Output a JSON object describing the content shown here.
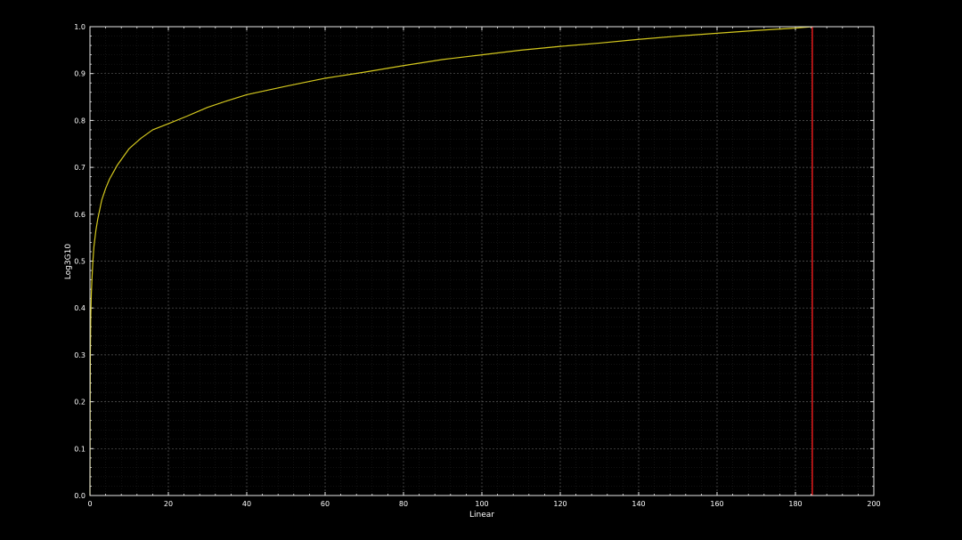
{
  "chart_data": {
    "type": "line",
    "title": "",
    "xlabel": "Linear",
    "ylabel": "Log3G10",
    "xlim": [
      0,
      200
    ],
    "ylim": [
      0,
      1
    ],
    "x_ticks": [
      "0",
      "20",
      "40",
      "60",
      "80",
      "100",
      "120",
      "140",
      "160",
      "180",
      "200"
    ],
    "y_ticks": [
      "0.0",
      "0.1",
      "0.2",
      "0.3",
      "0.4",
      "0.5",
      "0.6",
      "0.7",
      "0.8",
      "0.9",
      "1.0"
    ],
    "grid": true,
    "series": [
      {
        "color": "#d4c81e",
        "x": [
          0,
          0.05,
          0.1,
          0.2,
          0.35,
          0.5,
          0.75,
          1,
          1.5,
          2,
          3,
          4,
          5,
          7,
          10,
          13,
          16,
          20,
          25,
          30,
          35,
          40,
          50,
          60,
          70,
          80,
          90,
          100,
          110,
          120,
          130,
          140,
          150,
          160,
          170,
          180,
          184.3
        ],
        "y": [
          0.0,
          0.2,
          0.3,
          0.38,
          0.43,
          0.46,
          0.5,
          0.53,
          0.565,
          0.59,
          0.63,
          0.655,
          0.675,
          0.705,
          0.74,
          0.762,
          0.78,
          0.793,
          0.81,
          0.828,
          0.842,
          0.855,
          0.873,
          0.89,
          0.903,
          0.917,
          0.93,
          0.94,
          0.95,
          0.958,
          0.965,
          0.973,
          0.98,
          0.986,
          0.992,
          0.997,
          1.0
        ]
      }
    ],
    "vertical_line": {
      "x": 184.3,
      "color": "#e31a1c"
    },
    "colors": {
      "background": "#000000",
      "axis": "#e8e8e8",
      "grid": "#5a5a5a",
      "text": "#ffffff"
    }
  }
}
